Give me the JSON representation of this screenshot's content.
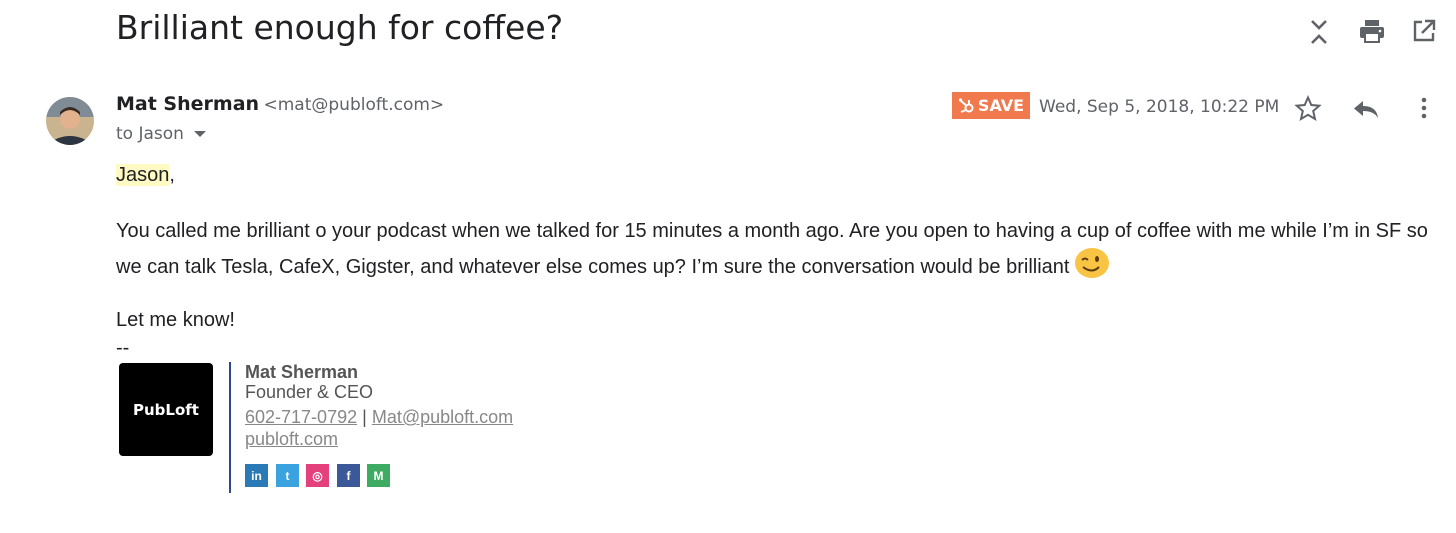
{
  "email": {
    "subject": "Brilliant enough for coffee?",
    "sender_name": "Mat Sherman",
    "sender_email": "<mat@publoft.com>",
    "to_text": "to Jason",
    "save_label": "SAVE",
    "date": "Wed, Sep 5, 2018, 10:22 PM"
  },
  "body": {
    "greeting_name": "Jason",
    "greeting_punct": ",",
    "paragraph": "You called me brilliant o your podcast when we talked for 15 minutes a month ago. Are you open to having a cup of coffee with me while I’m in SF so we can talk Tesla, CafeX, Gigster, and whatever else comes up? I’m sure the conversation would be brilliant",
    "closing": "Let me know!",
    "sig_separator": "--"
  },
  "signature": {
    "logo_text": "PubLoft",
    "name": "Mat Sherman",
    "title": "Founder & CEO",
    "phone": "602-717-0792",
    "separator": "|",
    "email": "Mat@publoft.com",
    "website": "publoft.com"
  },
  "social": [
    {
      "icon": "linkedin-icon",
      "glyph": "in",
      "color": "#2a7ab8"
    },
    {
      "icon": "twitter-icon",
      "glyph": "t",
      "color": "#3aa2df"
    },
    {
      "icon": "instagram-icon",
      "glyph": "◎",
      "color": "#e4407b"
    },
    {
      "icon": "facebook-icon",
      "glyph": "f",
      "color": "#3b5998"
    },
    {
      "icon": "medium-icon",
      "glyph": "M",
      "color": "#3dab62"
    }
  ],
  "colors": {
    "save_button": "#f07a4e",
    "highlight": "#fff9c4",
    "signature_divider": "#2b4a8b"
  }
}
